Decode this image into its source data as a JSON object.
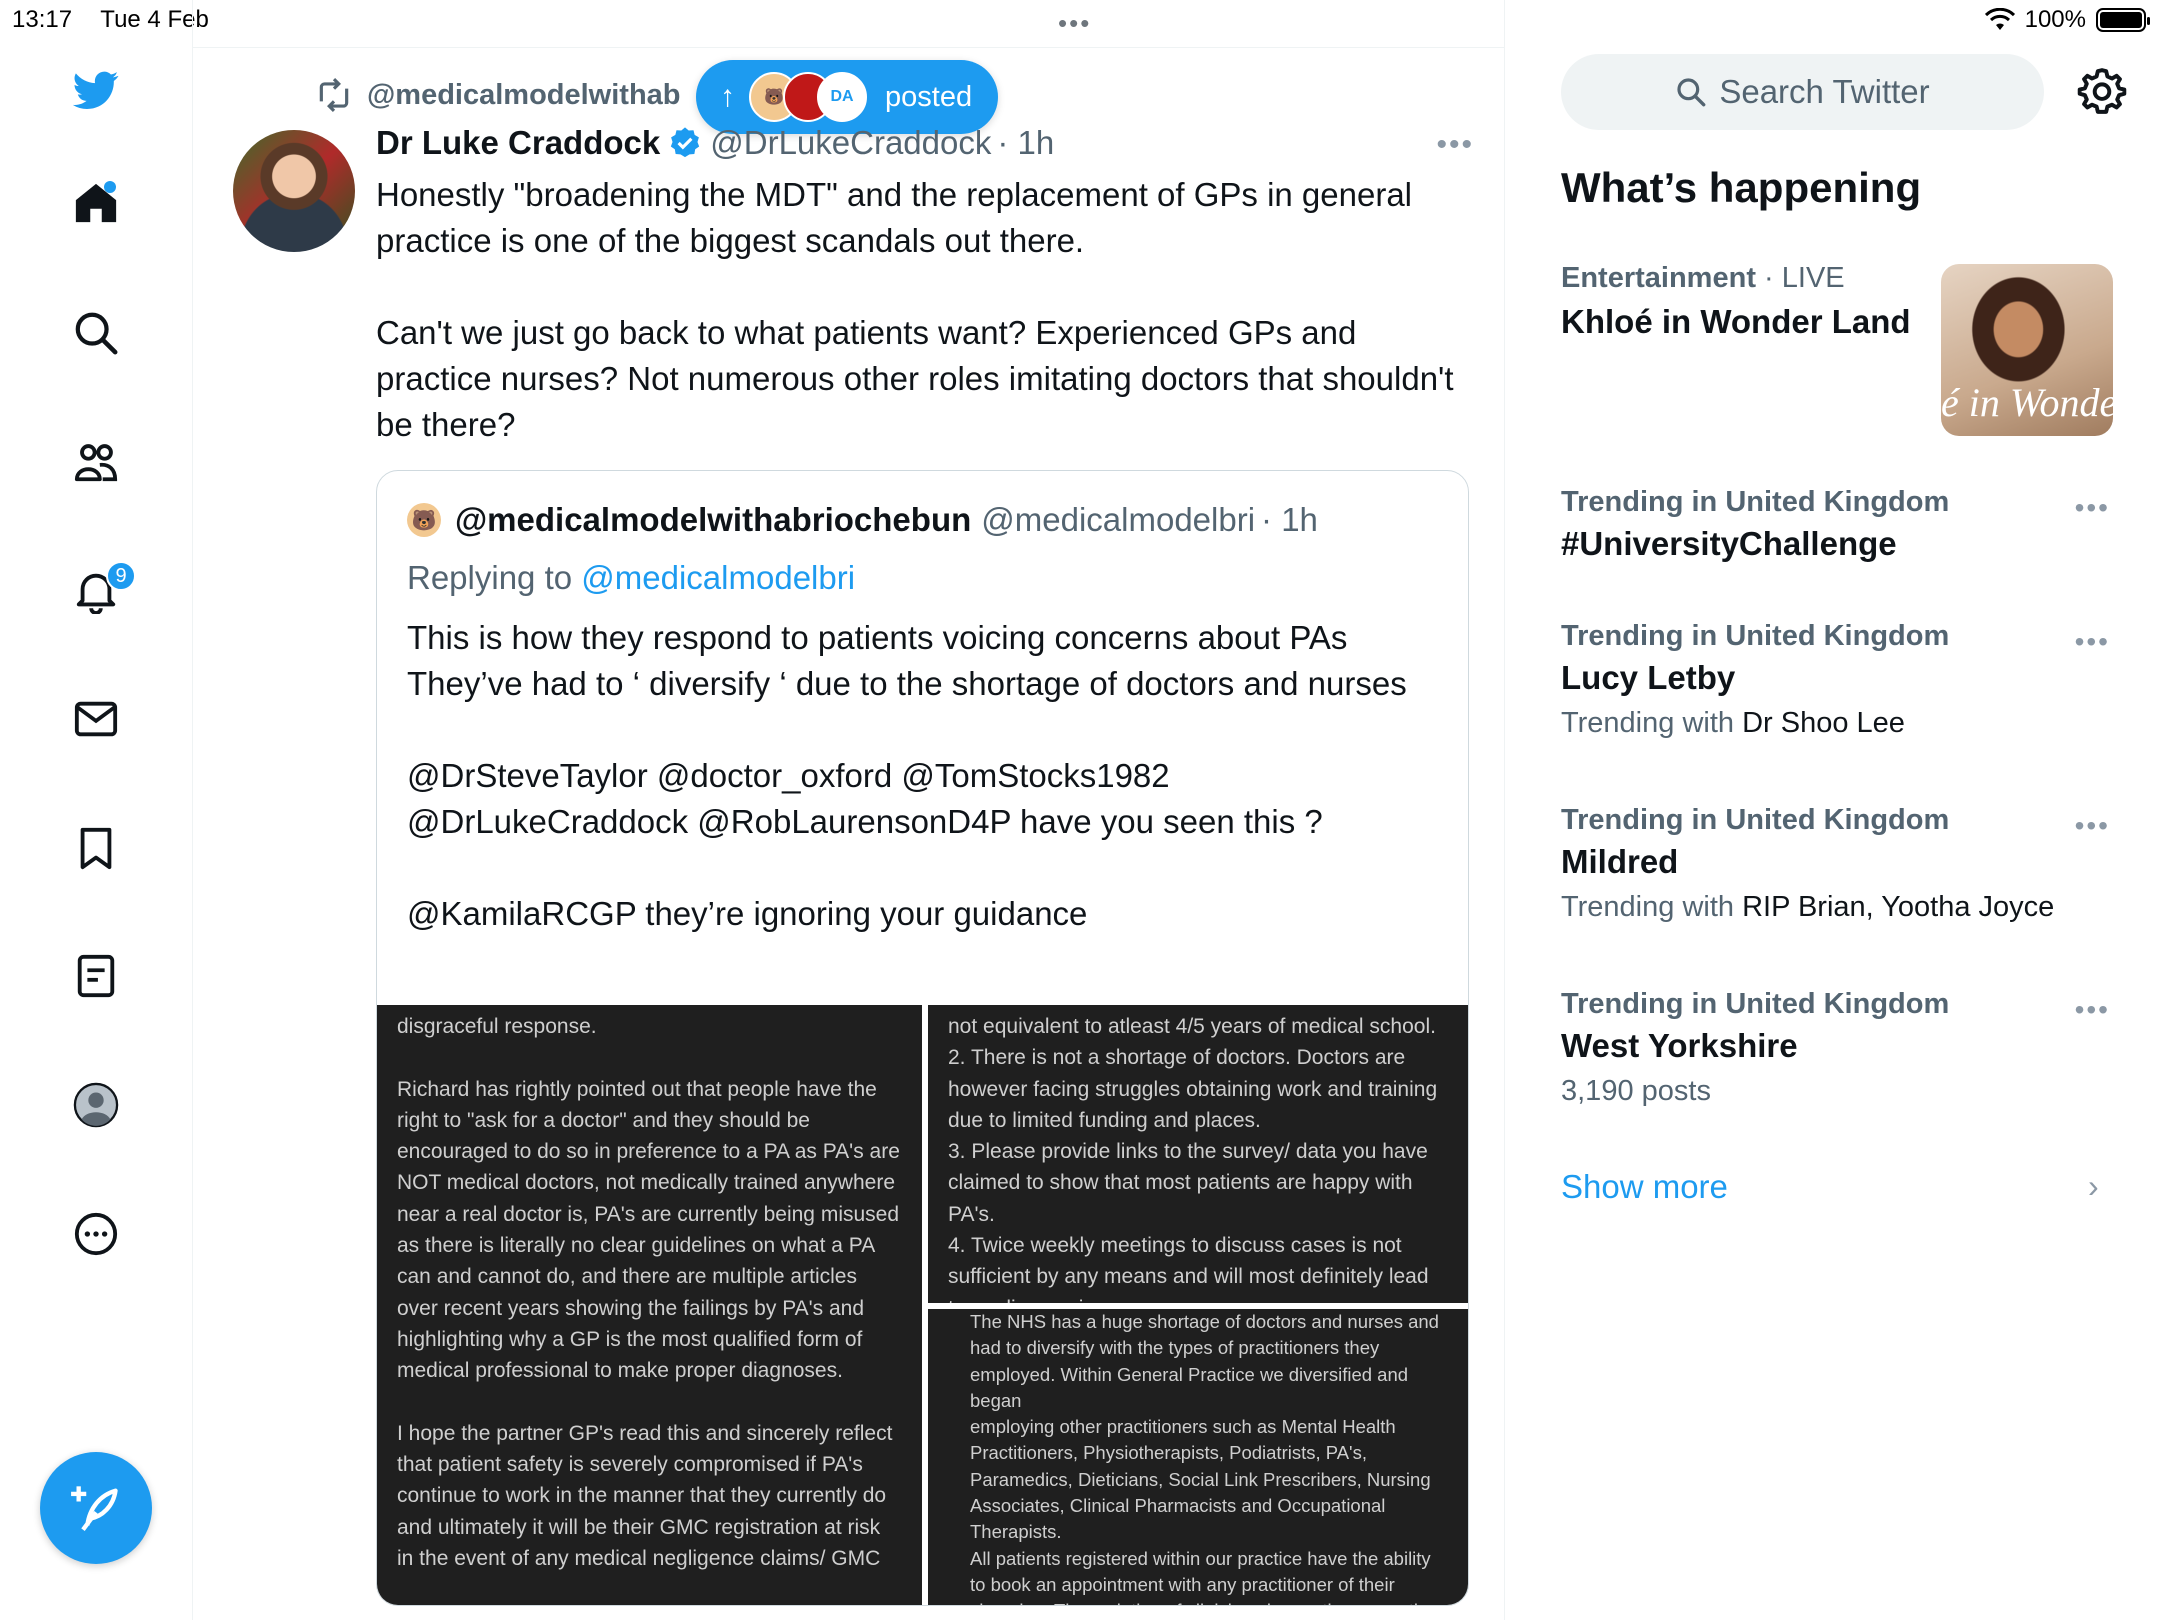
{
  "status_bar": {
    "time": "13:17",
    "date": "Tue 4 Feb",
    "battery": "100%"
  },
  "nav": {
    "items": [
      "twitter-logo",
      "home",
      "search",
      "communities",
      "notifications",
      "messages",
      "bookmarks",
      "lists",
      "profile",
      "more"
    ],
    "notifications_count": "9"
  },
  "tweet": {
    "retweeted_by": "@medicalmodelwithab",
    "posted_pill": {
      "label": "posted",
      "avatar3_text": "DA"
    },
    "author_name": "Dr Luke Craddock",
    "author_handle": "@DrLukeCraddock",
    "time": "· 1h",
    "text": "Honestly \"broadening the MDT\" and the replacement of GPs in general practice is one of the biggest scandals out there.\n\nCan't we just go back to what patients want? Experienced GPs and practice nurses? Not numerous other roles imitating doctors that shouldn't be there?",
    "quote": {
      "name": "@medicalmodelwithabriochebun",
      "handle": "@medicalmodelbri",
      "time": "· 1h",
      "replying_prefix": "Replying to",
      "replying_to": "@medicalmodelbri",
      "text": "This is how they respond to patients voicing concerns about PAs\nThey’ve had to ‘ diversify ‘ due to the shortage of doctors and nurses\n\n@DrSteveTaylor @doctor_oxford @TomStocks1982 @DrLukeCraddock @RobLaurensonD4P have you seen this ?\n\n@KamilaRCGP they’re ignoring your guidance",
      "images": [
        "disgraceful response.\n\nRichard has rightly pointed out that people have the right to \"ask for a doctor\" and they should be encouraged to do so in preference to a PA as PA's are NOT medical doctors, not medically trained anywhere near a real doctor is, PA's are currently being misused as there is literally no clear guidelines on what a PA can and cannot do, and there are multiple articles over recent years showing the failings by PA's and highlighting why a GP is the most qualified form of medical professional to make proper diagnoses.\n\nI hope the partner GP's read this and sincerely reflect that patient safety is severely compromised if PA's continue to work in the manner that they currently do and ultimately it will be their GMC registration at risk in the event of any medical negligence claims/ GMC",
        "not equivalent to atleast 4/5 years of medical school.\n2. There is not a shortage of doctors. Doctors are however facing struggles obtaining work and training due to limited funding and places.\n3. Please provide links to the survey/ data you have claimed to show that most patients are happy with PA's.\n4. Twice weekly meetings to discuss cases is not sufficient by any means and will most definitely lead to negligence in care.",
        "The NHS has a huge shortage of doctors and nurses and had to diversify with the types of practitioners they employed. Within General Practice we diversified and began\nemploying other practitioners such as Mental Health Practitioners, Physiotherapists, Podiatrists, PA's, Paramedics, Dieticians, Social Link Prescribers, Nursing Associates, Clinical Pharmacists and Occupational Therapists.\nAll patients registered within our practice have the ability to book an appointment with any practitioner of their choosing. The variation of clinicians in practice currently"
      ]
    }
  },
  "sidebar": {
    "search_placeholder": "Search Twitter",
    "whats_happening": "What’s happening",
    "featured": {
      "category": "Entertainment",
      "live": "· LIVE",
      "title": "Khloé in Wonder Land",
      "thumb_text": "é in Wonder L"
    },
    "trends": [
      {
        "meta": "Trending in United Kingdom",
        "title": "#UniversityChallenge",
        "sub_prefix": "",
        "sub_value": ""
      },
      {
        "meta": "Trending in United Kingdom",
        "title": "Lucy Letby",
        "sub_prefix": "Trending with",
        "sub_value": "Dr Shoo Lee"
      },
      {
        "meta": "Trending in United Kingdom",
        "title": "Mildred",
        "sub_prefix": "Trending with",
        "sub_value": "RIP Brian, Yootha Joyce"
      },
      {
        "meta": "Trending in United Kingdom",
        "title": "West Yorkshire",
        "sub_prefix": "3,190 posts",
        "sub_value": ""
      }
    ],
    "show_more": "Show more"
  },
  "colors": {
    "accent": "#1d9bf0",
    "text": "#0f1419",
    "muted": "#536471"
  }
}
